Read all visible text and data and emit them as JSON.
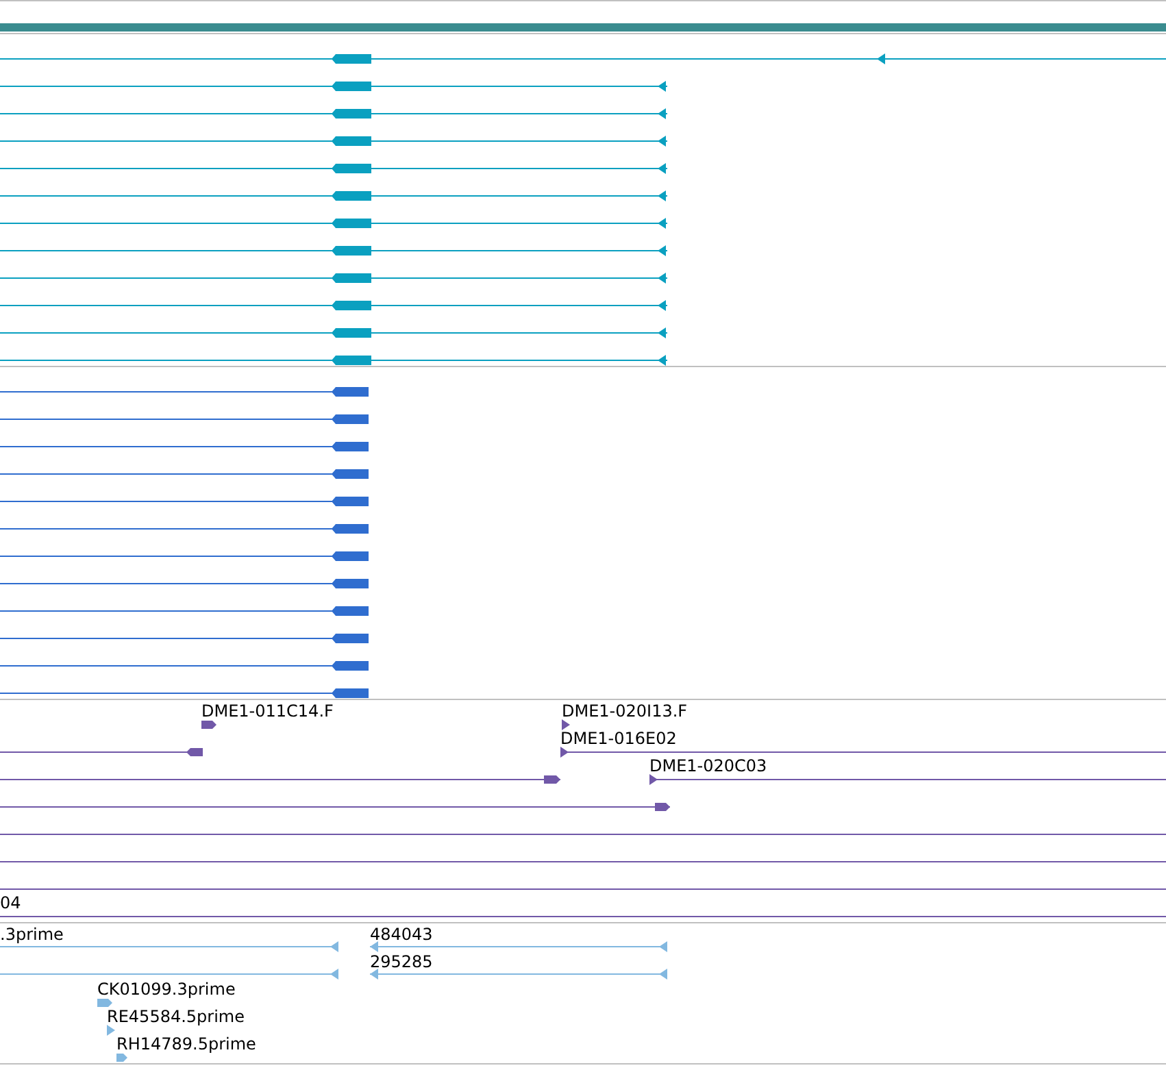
{
  "tracks": [
    {
      "kind": "thick",
      "color": "#0aa0c0"
    },
    {
      "kind": "thick",
      "color": "#2f6dcf"
    },
    {
      "kind": "thin",
      "color": "#7158a8",
      "labels": [
        "DME1-011C14.F",
        "DME1-020I13.F",
        "DME1-016E02",
        "DME1-020C03",
        "04"
      ]
    },
    {
      "kind": "thin",
      "color": "#82b8e0",
      "labels": [
        ".3prime",
        "484043",
        "295285",
        "CK01099.3prime",
        "RE45584.5prime",
        "RH14789.5prime"
      ]
    }
  ]
}
